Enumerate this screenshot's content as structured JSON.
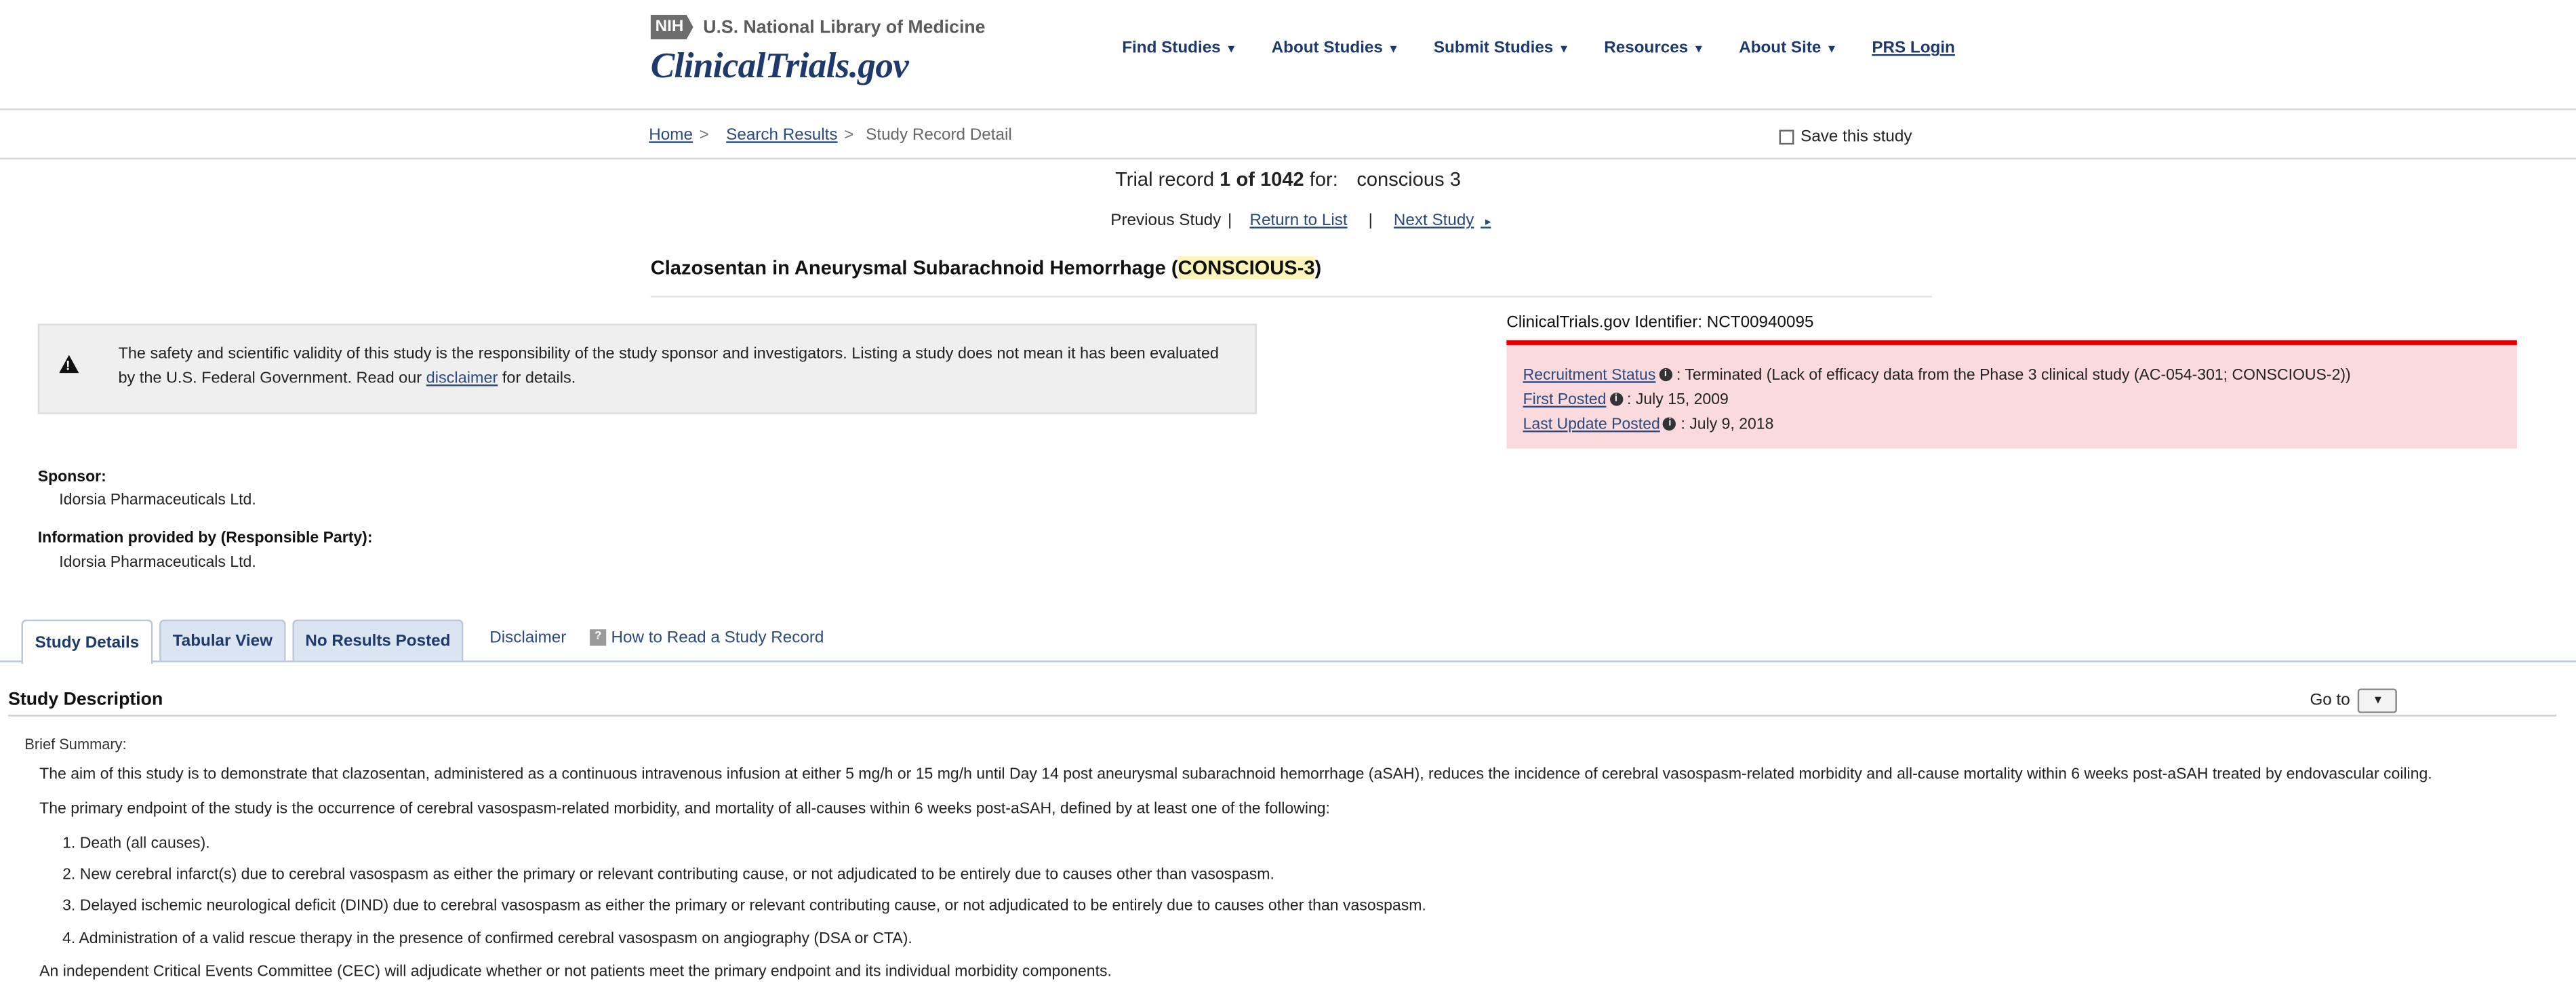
{
  "header": {
    "nih_badge": "NIH",
    "nih_name": "U.S. National Library of Medicine",
    "brand": "ClinicalTrials.gov",
    "nav": [
      {
        "label": "Find Studies"
      },
      {
        "label": "About Studies"
      },
      {
        "label": "Submit Studies"
      },
      {
        "label": "Resources"
      },
      {
        "label": "About Site"
      }
    ],
    "prs_login": "PRS Login"
  },
  "breadcrumb": {
    "home": "Home",
    "search_results": "Search Results",
    "current": "Study Record Detail",
    "separator": ">",
    "save_label": "Save this study"
  },
  "trial_record": {
    "prefix": "Trial record",
    "position": "1 of 1042",
    "for": "for:",
    "term": "conscious 3"
  },
  "pager": {
    "previous": "Previous Study",
    "bar": "|",
    "return": "Return to List",
    "next": "Next Study",
    "next_arrow": "▸"
  },
  "study": {
    "title_before": "Clazosentan in Aneurysmal Subarachnoid Hemorrhage (",
    "title_highlight": "CONSCIOUS-3",
    "title_after": ")",
    "identifier_label": "ClinicalTrials.gov Identifier:",
    "identifier": "NCT00940095"
  },
  "disclaimer": {
    "text_before": "The safety and scientific validity of this study is the responsibility of the study sponsor and investigators. Listing a study does not mean it has been evaluated by the U.S. Federal Government. Read our",
    "link": "disclaimer",
    "text_after": "for details."
  },
  "status": {
    "recruitment_label": "Recruitment Status",
    "recruitment_value": ": Terminated (Lack of efficacy data from the Phase 3 clinical study (AC-054-301; CONSCIOUS-2))",
    "first_posted_label": "First Posted",
    "first_posted_value": ": July 15, 2009",
    "last_update_label": "Last Update Posted",
    "last_update_value": ": July 9, 2018",
    "bar_color": "#e00000",
    "box_color": "#fadadd"
  },
  "sponsor": {
    "label": "Sponsor:",
    "value": "Idorsia Pharmaceuticals Ltd.",
    "responsible_label": "Information provided by (Responsible Party):",
    "responsible_value": "Idorsia Pharmaceuticals Ltd."
  },
  "tabs": {
    "study_details": "Study Details",
    "tabular_view": "Tabular View",
    "no_results": "No Results Posted",
    "disclaimer": "Disclaimer",
    "how_to_read": "How to Read a Study Record",
    "help_glyph": "?"
  },
  "description": {
    "section_title": "Study Description",
    "goto": "Go to",
    "goto_glyph": "▼",
    "brief_label": "Brief Summary:",
    "p1": "The aim of this study is to demonstrate that clazosentan, administered as a continuous intravenous infusion at either 5 mg/h or 15 mg/h until Day 14 post aneurysmal subarachnoid hemorrhage (aSAH), reduces the incidence of cerebral vasospasm-related morbidity and all-cause mortality within 6 weeks post-aSAH treated by endovascular coiling.",
    "p2": "The primary endpoint of the study is the occurrence of cerebral vasospasm-related morbidity, and mortality of all-causes within 6 weeks post-aSAH, defined by at least one of the following:",
    "items": [
      "1. Death (all causes).",
      "2. New cerebral infarct(s) due to cerebral vasospasm as either the primary or relevant contributing cause, or not adjudicated to be entirely due to causes other than vasospasm.",
      "3. Delayed ischemic neurological deficit (DIND) due to cerebral vasospasm as either the primary or relevant contributing cause, or not adjudicated to be entirely due to causes other than vasospasm.",
      "4. Administration of a valid rescue therapy in the presence of confirmed cerebral vasospasm on angiography (DSA or CTA)."
    ],
    "p3": "An independent Critical Events Committee (CEC) will adjudicate whether or not patients meet the primary endpoint and its individual morbidity components."
  }
}
